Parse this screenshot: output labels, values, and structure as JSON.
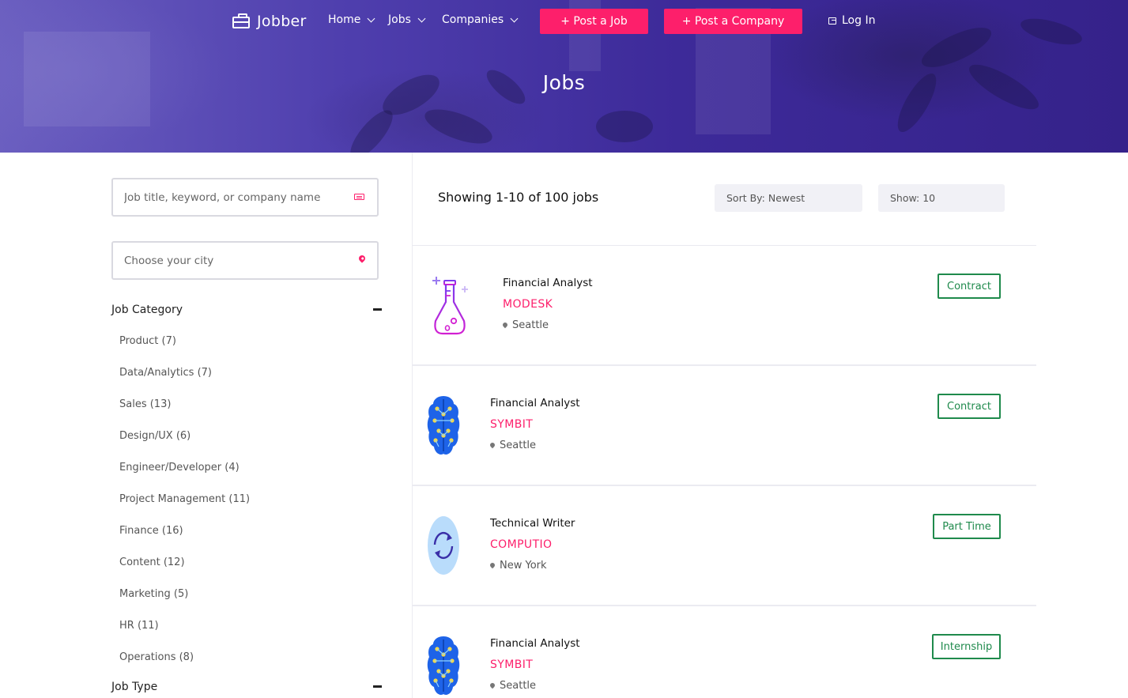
{
  "nav": {
    "brand": "Jobber",
    "items": [
      "Home",
      "Jobs",
      "Companies"
    ],
    "post_job": "+ Post a Job",
    "post_company": "+ Post a Company",
    "login": "Log In"
  },
  "hero": {
    "title": "Jobs"
  },
  "search": {
    "keyword_placeholder": "Job title, keyword, or company name",
    "city_placeholder": "Choose your city"
  },
  "filters": {
    "job_category_title": "Job Category",
    "categories": [
      "Product (7)",
      "Data/Analytics (7)",
      "Sales (13)",
      "Design/UX (6)",
      "Engineer/Developer (4)",
      "Project Management (11)",
      "Finance (16)",
      "Content (12)",
      "Marketing (5)",
      "HR (11)",
      "Operations (8)"
    ],
    "job_type_title": "Job Type"
  },
  "results": {
    "showing": "Showing 1-10 of 100 jobs",
    "sort_by": "Sort By: Newest",
    "show": "Show: 10"
  },
  "jobs": [
    {
      "title": "Financial Analyst",
      "company": "MODESK",
      "location": "Seattle",
      "type": "Contract",
      "logo": "flask-icon"
    },
    {
      "title": "Financial Analyst",
      "company": "SYMBIT",
      "location": "Seattle",
      "type": "Contract",
      "logo": "brain-circuit-icon"
    },
    {
      "title": "Technical Writer",
      "company": "COMPUTIO",
      "location": "New York",
      "type": "Part Time",
      "logo": "refresh-circle-icon"
    },
    {
      "title": "Financial Analyst",
      "company": "SYMBIT",
      "location": "Seattle",
      "type": "Internship",
      "logo": "brain-circuit-icon"
    }
  ],
  "colors": {
    "accent": "#fd1f6b",
    "job_type": "#1f8a4c",
    "hero": "#3d2a99"
  }
}
